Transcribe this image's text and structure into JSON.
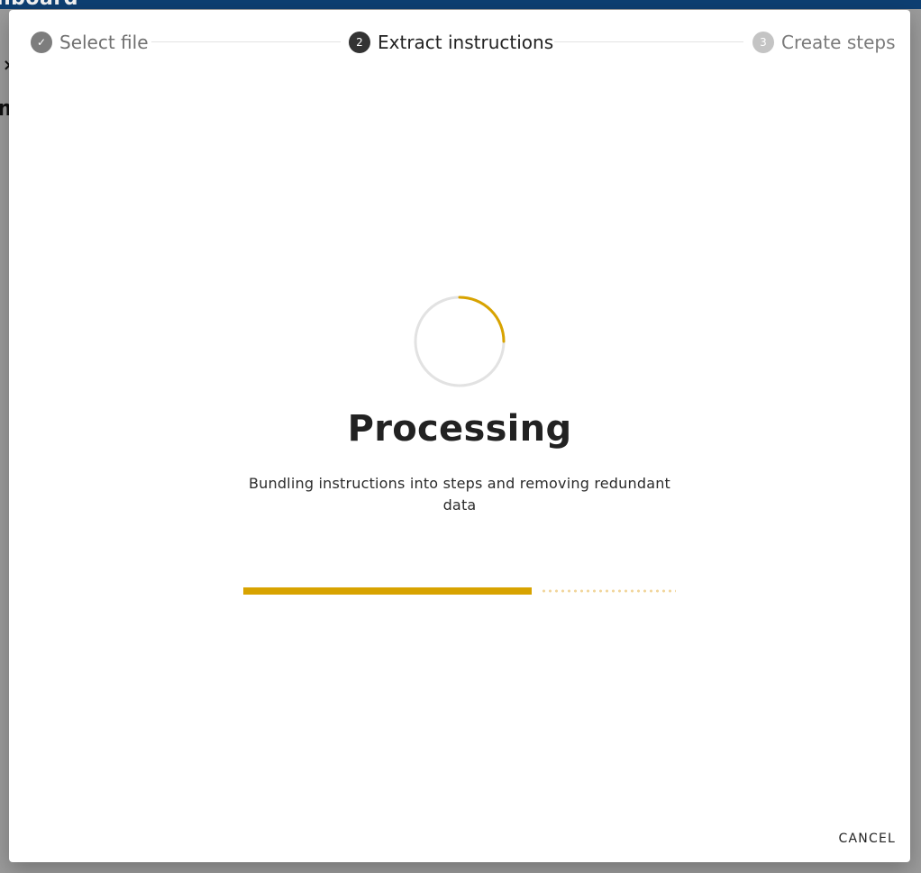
{
  "app": {
    "logo_text": "nboard"
  },
  "background": {
    "close_glyph": "×",
    "title_fragment": "m"
  },
  "stepper": {
    "steps": [
      {
        "number": "✓",
        "label": "Select file",
        "state": "completed"
      },
      {
        "number": "2",
        "label": "Extract instructions",
        "state": "active"
      },
      {
        "number": "3",
        "label": "Create steps",
        "state": "pending"
      }
    ]
  },
  "processing": {
    "title": "Processing",
    "description": "Bundling instructions into steps and removing redundant data",
    "progress_value": 0.667,
    "buffer_value": 1.0
  },
  "actions": {
    "cancel_label": "CANCEL"
  },
  "colors": {
    "accent": "#d8a300",
    "buffer": "#f1d59a",
    "header": "#0e3f72",
    "step_completed": "#7d7d7d",
    "step_active": "#333333",
    "step_pending": "#c4c4c4"
  },
  "icons": {
    "step_completed": "check-icon",
    "spinner": "progress-spinner",
    "close": "close-icon"
  }
}
